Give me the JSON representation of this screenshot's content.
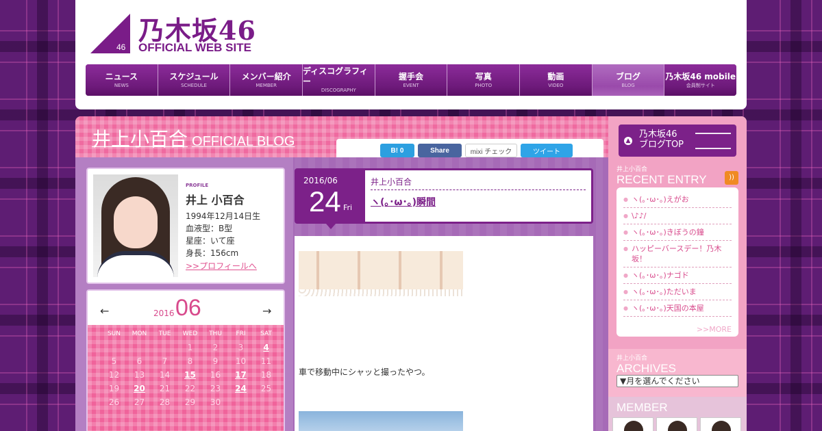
{
  "logo": {
    "small_num": "46",
    "jp": "乃木坂46",
    "en": "OFFICIAL WEB SITE"
  },
  "nav": [
    {
      "jp": "ニュース",
      "en": "NEWS"
    },
    {
      "jp": "スケジュール",
      "en": "SCHEDULE"
    },
    {
      "jp": "メンバー紹介",
      "en": "MEMBER"
    },
    {
      "jp": "ディスコグラフィー",
      "en": "DISCOGRAPHY"
    },
    {
      "jp": "握手会",
      "en": "EVENT"
    },
    {
      "jp": "写真",
      "en": "PHOTO"
    },
    {
      "jp": "動画",
      "en": "VIDEO"
    },
    {
      "jp": "ブログ",
      "en": "BLOG"
    },
    {
      "jp": "乃木坂46 mobile",
      "en": "会員制サイト"
    }
  ],
  "blog": {
    "name": "井上小百合",
    "sub": "OFFICIAL BLOG"
  },
  "share": {
    "hatena": "B! 0",
    "facebook": "Share",
    "mixi": "mixi チェック",
    "twitter": "ツイート"
  },
  "profile": {
    "label": "PROFILE",
    "name": "井上 小百合",
    "birthday": "1994年12月14日生",
    "blood": "血液型：B型",
    "sign": "星座：いて座",
    "height": "身長：156cm",
    "link": ">>プロフィールへ"
  },
  "calendar": {
    "prev": "←",
    "next": "→",
    "year": "2016",
    "month": "06",
    "dow": [
      "SUN",
      "MON",
      "TUE",
      "WED",
      "THU",
      "FRI",
      "SAT"
    ],
    "days": [
      "",
      "",
      "",
      "1",
      "2",
      "3",
      "4",
      "5",
      "6",
      "7",
      "8",
      "9",
      "10",
      "11",
      "12",
      "13",
      "14",
      "15",
      "16",
      "17",
      "18",
      "19",
      "20",
      "21",
      "22",
      "23",
      "24",
      "25",
      "26",
      "27",
      "28",
      "29",
      "30",
      "",
      ""
    ],
    "linked_days": [
      "4",
      "15",
      "17",
      "20",
      "24"
    ]
  },
  "entry": {
    "year_month": "2016/06",
    "day": "24",
    "dow": "Fri",
    "author": "井上小百合",
    "title": "ヽ(｡･ω･｡)瞬間",
    "body_text": "車で移動中にシャッと撮ったやつ。"
  },
  "sidebar": {
    "blogtop_label_1": "乃木坂46",
    "blogtop_label_2": "ブログTOP",
    "recent_small": "井上小百合",
    "recent_title": "RECENT ENTRY",
    "recent": [
      "ヽ(｡･ω･｡)えがお",
      "\\♪♪/",
      "ヽ(｡･ω･｡)きぼうの鐘",
      "ハッピーバースデー！乃木坂！",
      "ヽ(｡･ω･｡)ナゴド",
      "ヽ(｡･ω･｡)ただいま",
      "ヽ(｡･ω･｡)天国の本屋"
    ],
    "more": ">>MORE",
    "archives_small": "井上小百合",
    "archives_title": "ARCHIVES",
    "archives_select": "▼月を選んでください",
    "member_title": "MEMBER"
  },
  "colors": {
    "accent": "#7c2189",
    "pink": "#ef6aa0",
    "sidebar": "#f2a3c4"
  }
}
